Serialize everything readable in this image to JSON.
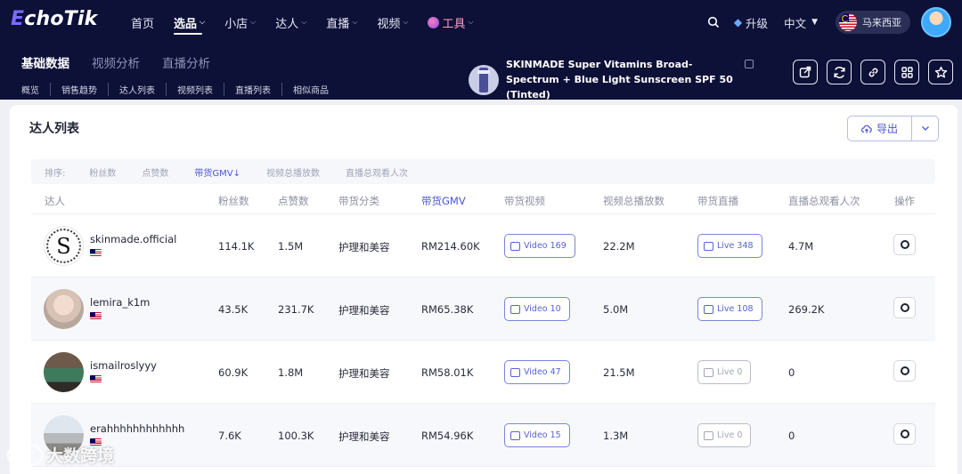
{
  "app": {
    "logo_prefix": "E",
    "logo_rest": "choTik"
  },
  "nav": [
    {
      "label": "首页",
      "has_chevron": false
    },
    {
      "label": "选品",
      "has_chevron": true,
      "active": true
    },
    {
      "label": "小店",
      "has_chevron": true
    },
    {
      "label": "达人",
      "has_chevron": true
    },
    {
      "label": "直播",
      "has_chevron": true
    },
    {
      "label": "视频",
      "has_chevron": true
    },
    {
      "label": "工具",
      "has_chevron": true,
      "icon": "tool-icon"
    }
  ],
  "header_right": {
    "upgrade": "升级",
    "language": "中文",
    "region": "马来西亚"
  },
  "subtabs": [
    "基础数据",
    "视频分析",
    "直播分析"
  ],
  "crumbs": [
    "概览",
    "销售趋势",
    "达人列表",
    "视频列表",
    "直播列表",
    "相似商品"
  ],
  "product": {
    "name": "SKINMADE Super Vitamins Broad-Spectrum + Blue Light Sunscreen SPF 50 (Tinted)"
  },
  "action_icons": [
    "share-icon",
    "refresh-icon",
    "link-icon",
    "grid-icon",
    "star-icon"
  ],
  "card": {
    "title": "达人列表",
    "export_label": "导出"
  },
  "sortbar": {
    "label": "排序:",
    "options": [
      "粉丝数",
      "点赞数",
      "带货GMV↓",
      "视频总播放数",
      "直播总观看人次"
    ],
    "active_index": 2
  },
  "columns": [
    "达人",
    "粉丝数",
    "点赞数",
    "带货分类",
    "带货GMV",
    "带货视频",
    "视频总播放数",
    "带货直播",
    "直播总观看人次",
    "操作"
  ],
  "rows": [
    {
      "name": "skinmade.official",
      "avatar": "skinmade-logo",
      "followers": "114.1K",
      "likes": "1.5M",
      "category": "护理和美容",
      "gmv": "RM214.60K",
      "video_chip": "Video 169",
      "video_plays": "22.2M",
      "live_chip": "Live 348",
      "live_views": "4.7M"
    },
    {
      "name": "lemira_k1m",
      "avatar": "user-photo",
      "followers": "43.5K",
      "likes": "231.7K",
      "category": "护理和美容",
      "gmv": "RM65.38K",
      "video_chip": "Video 10",
      "video_plays": "5.0M",
      "live_chip": "Live 108",
      "live_views": "269.2K"
    },
    {
      "name": "ismailroslyyy",
      "avatar": "user-photo",
      "followers": "60.9K",
      "likes": "1.8M",
      "category": "护理和美容",
      "gmv": "RM58.01K",
      "video_chip": "Video 47",
      "video_plays": "21.5M",
      "live_chip": "Live 0",
      "live_views": "0"
    },
    {
      "name": "erahhhhhhhhhhhh",
      "avatar": "user-photo",
      "followers": "7.6K",
      "likes": "100.3K",
      "category": "护理和美容",
      "gmv": "RM54.96K",
      "video_chip": "Video 15",
      "video_plays": "1.3M",
      "live_chip": "Live 0",
      "live_views": "0"
    }
  ],
  "watermark": "大数跨境",
  "colors": {
    "header_bg": "#0d1037",
    "accent": "#4a55d6",
    "page_bg": "#eef0f6"
  }
}
